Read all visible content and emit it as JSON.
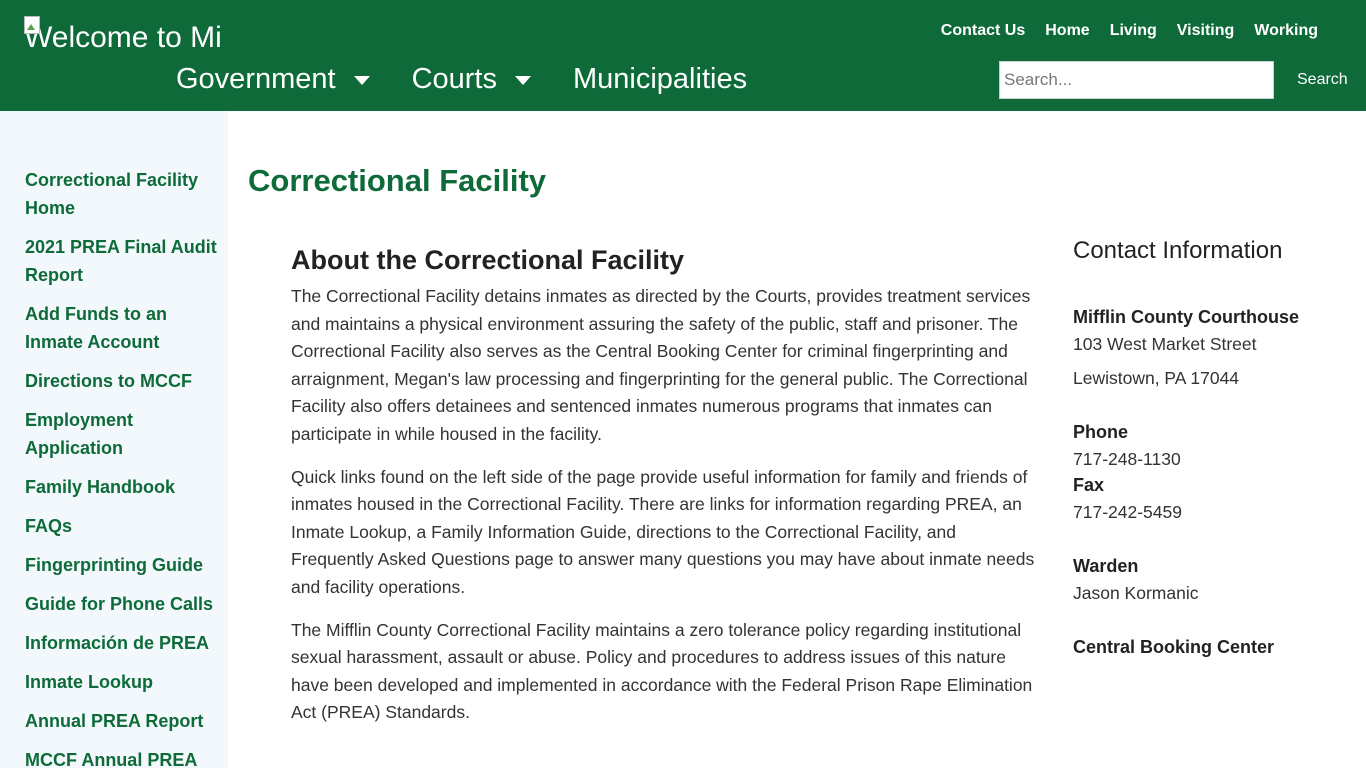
{
  "header": {
    "logo_text": "Welcome to Mifflin County",
    "utility_nav": [
      "Contact Us",
      "Home",
      "Living",
      "Visiting",
      "Working"
    ],
    "main_nav": [
      {
        "label": "Government",
        "has_dropdown": true
      },
      {
        "label": "Courts",
        "has_dropdown": true
      },
      {
        "label": "Municipalities",
        "has_dropdown": false
      }
    ],
    "search": {
      "placeholder": "Search...",
      "value": "",
      "button_label": "Search"
    }
  },
  "sidebar": {
    "items": [
      "Correctional Facility Home",
      "2021 PREA Final Audit Report",
      "Add Funds to an Inmate Account",
      "Directions to MCCF",
      "Employment Application",
      "Family Handbook",
      "FAQs",
      "Fingerprinting Guide",
      "Guide for Phone Calls",
      "Información de PREA",
      "Inmate Lookup",
      "Annual PREA Report",
      "MCCF Annual PREA"
    ]
  },
  "main": {
    "page_title": "Correctional Facility",
    "section_heading": "About the Correctional Facility",
    "paragraphs": [
      "The Correctional Facility detains inmates as directed by the Courts, provides treatment services and maintains a physical environment assuring the safety of the public, staff and prisoner.  The Correctional Facility also serves as the Central Booking Center for criminal fingerprinting and arraignment, Megan's law processing and fingerprinting for the general public.  The Correctional Facility also offers detainees and sentenced inmates numerous programs that inmates can participate in while housed in the facility.",
      "Quick links found on the left side of the page provide useful information for family and friends of inmates housed in the Correctional Facility.  There are links for information regarding PREA, an Inmate Lookup, a Family Information Guide, directions to the Correctional Facility, and Frequently Asked Questions page to answer many questions you may have about inmate needs and facility operations.",
      "The Mifflin County Correctional Facility maintains a zero tolerance policy regarding institutional sexual harassment, assault or abuse. Policy and procedures to address issues of this nature have been developed and implemented in accordance with the Federal Prison Rape Elimination Act (PREA) Standards."
    ]
  },
  "contact": {
    "heading": "Contact Information",
    "location_name": "Mifflin County Courthouse",
    "address_line1": "103 West Market Street",
    "address_line2": "Lewistown, PA 17044",
    "phone_label": "Phone",
    "phone": "717-248-1130",
    "fax_label": "Fax",
    "fax": "717-242-5459",
    "warden_label": "Warden",
    "warden": "Jason Kormanic",
    "booking_label": "Central Booking Center"
  },
  "colors": {
    "brand_green": "#0e6b39",
    "sidebar_bg": "#f2f8fb"
  }
}
